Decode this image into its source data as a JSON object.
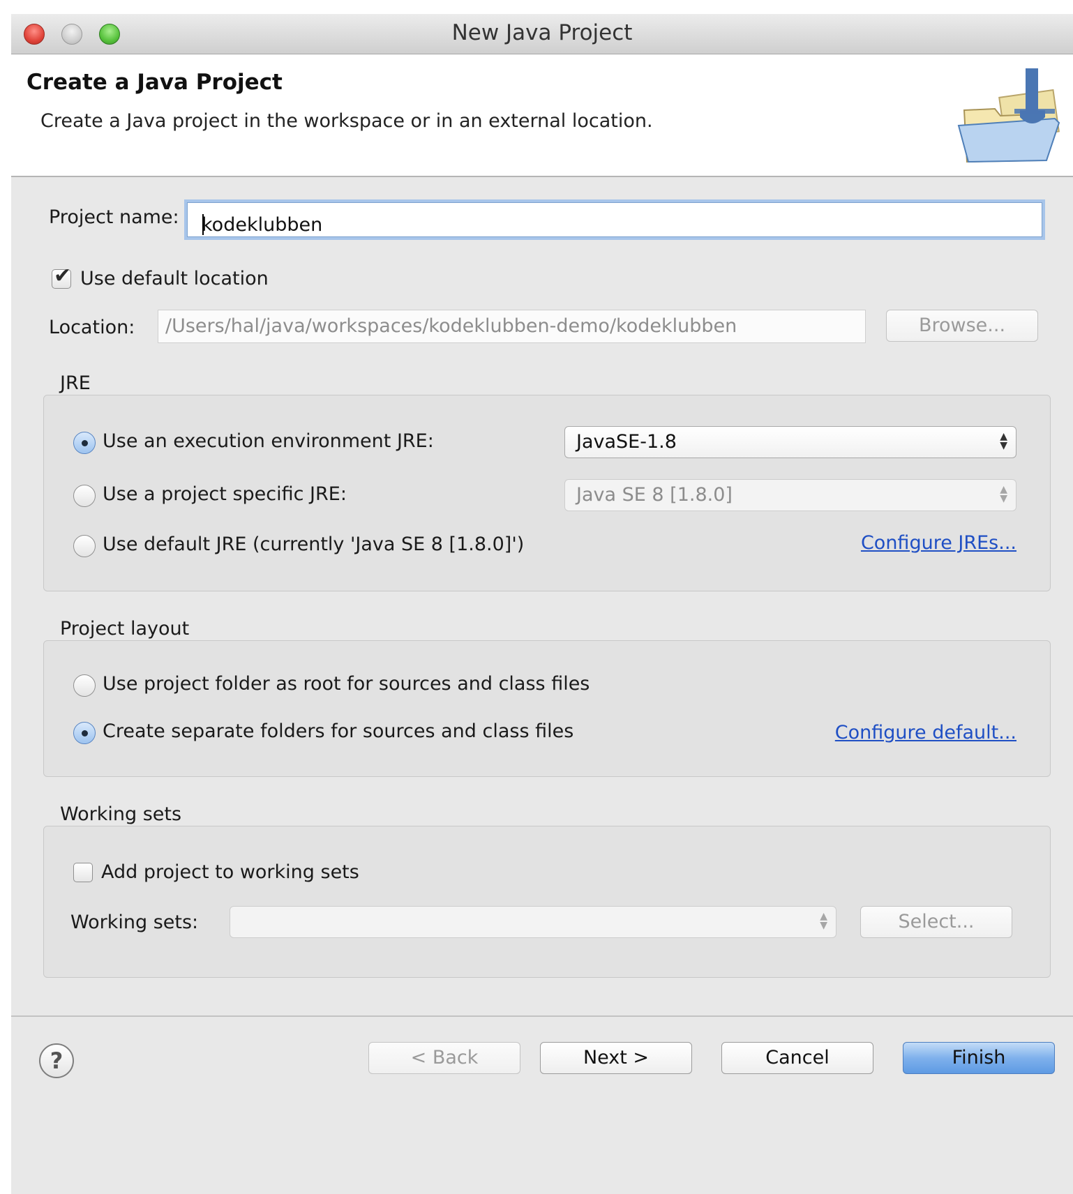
{
  "window": {
    "title": "New Java Project"
  },
  "header": {
    "title": "Create a Java Project",
    "description": "Create a Java project in the workspace or in an external location."
  },
  "project_name": {
    "label": "Project name:",
    "value": "kodeklubben"
  },
  "default_location": {
    "label": "Use default location",
    "checked": true
  },
  "location": {
    "label": "Location:",
    "value": "/Users/hal/java/workspaces/kodeklubben-demo/kodeklubben",
    "browse_label": "Browse..."
  },
  "jre": {
    "group_label": "JRE",
    "option_exec_env": "Use an execution environment JRE:",
    "exec_env_value": "JavaSE-1.8",
    "option_project_specific": "Use a project specific JRE:",
    "project_specific_value": "Java SE 8 [1.8.0]",
    "option_default": "Use default JRE (currently 'Java SE 8 [1.8.0]')",
    "configure_link": "Configure JREs..."
  },
  "layout": {
    "group_label": "Project layout",
    "option_root": "Use project folder as root for sources and class files",
    "option_separate": "Create separate folders for sources and class files",
    "configure_link": "Configure default..."
  },
  "working_sets": {
    "group_label": "Working sets",
    "checkbox_label": "Add project to working sets",
    "field_label": "Working sets:",
    "select_value": "",
    "select_button": "Select..."
  },
  "footer": {
    "help_symbol": "?",
    "back_label": "< Back",
    "next_label": "Next >",
    "cancel_label": "Cancel",
    "finish_label": "Finish"
  }
}
